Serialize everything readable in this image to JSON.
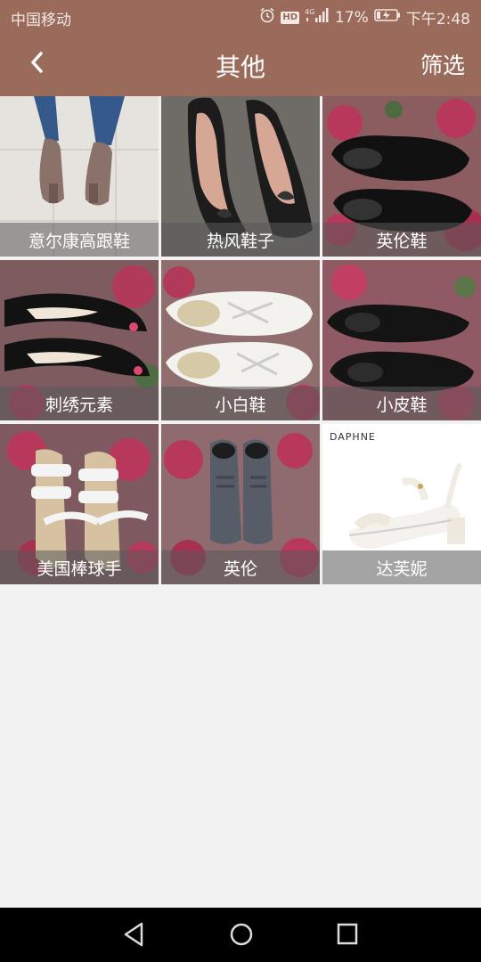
{
  "status_bar": {
    "carrier": "中国移动",
    "icons": [
      "alarm-icon",
      "hd-icon",
      "signal-4g-icon",
      "battery-icon"
    ],
    "hd_label": "HD",
    "battery": "17%",
    "time": "下午2:48"
  },
  "header": {
    "back_icon": "chevron-left-icon",
    "title": "其他",
    "filter_label": "筛选"
  },
  "grid": {
    "items": [
      {
        "label": "意尔康高跟鞋"
      },
      {
        "label": "热风鞋子"
      },
      {
        "label": "英伦鞋"
      },
      {
        "label": "刺绣元素"
      },
      {
        "label": "小白鞋"
      },
      {
        "label": "小皮鞋"
      },
      {
        "label": "美国棒球手"
      },
      {
        "label": "英伦"
      },
      {
        "label": "达芙妮",
        "brand_text": "DAPHNE"
      }
    ]
  },
  "colors": {
    "header_bg": "#9a6a5b",
    "page_bg": "#f2f2f2",
    "caption_bg": "rgba(90,90,90,0.55)"
  },
  "nav_bar": {
    "buttons": [
      "back-triangle-icon",
      "home-circle-icon",
      "recents-square-icon"
    ]
  }
}
